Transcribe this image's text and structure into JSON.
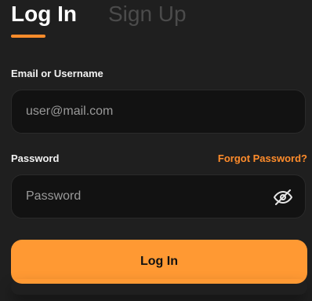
{
  "tabs": {
    "login_label": "Log In",
    "signup_label": "Sign Up"
  },
  "form": {
    "email": {
      "label": "Email or Username",
      "placeholder": "user@mail.com"
    },
    "password": {
      "label": "Password",
      "placeholder": "Password",
      "forgot_label": "Forgot Password?",
      "visibility_icon": "eye-off-icon"
    },
    "submit_label": "Log In"
  },
  "colors": {
    "background": "#1f1f1f",
    "accent": "#ff8c2b",
    "button": "#ff9933",
    "input_background": "#121212",
    "inactive_tab": "#4b4b4b"
  }
}
